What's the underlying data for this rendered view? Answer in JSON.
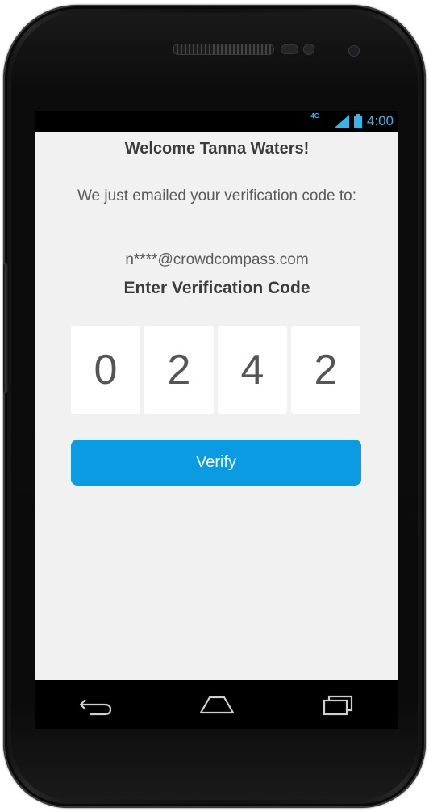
{
  "status_bar": {
    "network": "4G",
    "time": "4:00",
    "accent_color": "#35b6e9"
  },
  "verification": {
    "welcome": "Welcome Tanna Waters!",
    "message": "We just emailed your verification code to:",
    "email": "n****@crowdcompass.com",
    "enter_label": "Enter Verification Code",
    "code_digits": [
      "0",
      "2",
      "4",
      "2"
    ],
    "verify_label": "Verify",
    "button_color": "#0b9be2"
  },
  "nav": {
    "back_icon": "back-icon",
    "home_icon": "home-icon",
    "recents_icon": "recent-apps-icon"
  }
}
